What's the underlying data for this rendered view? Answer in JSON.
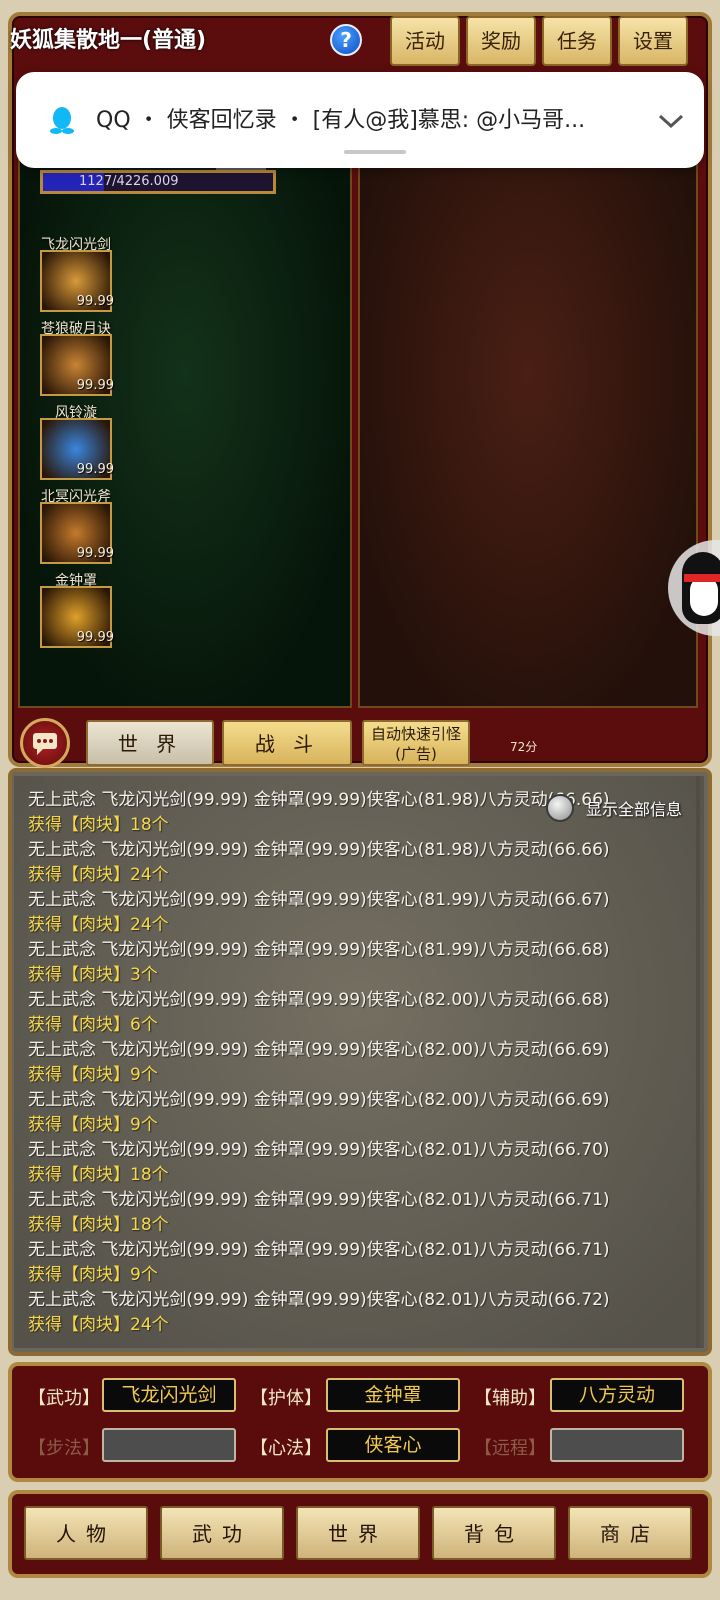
{
  "header": {
    "map_title": "妖狐集散地一(普通)",
    "help_glyph": "?",
    "buttons": [
      "活动",
      "奖励",
      "任务",
      "设置"
    ]
  },
  "notification": {
    "app": "QQ",
    "text": "QQ ・ 侠客回忆录 ・ [有人@我]慕思: @小马哥..."
  },
  "player": {
    "hp_text": "1127/4226.009",
    "hp_fraction": 0.267
  },
  "skills": [
    {
      "name": "飞龙闪光剑",
      "value": "99.99",
      "icon": "sword-slash-icon",
      "color": "#d89a3a"
    },
    {
      "name": "苍狼破月诀",
      "value": "99.99",
      "icon": "crescent-slash-icon",
      "color": "#c98435"
    },
    {
      "name": "风铃漩",
      "value": "99.99",
      "icon": "whirlwind-icon",
      "color": "#3a86e0"
    },
    {
      "name": "北冥闪光斧",
      "value": "99.99",
      "icon": "axe-icon",
      "color": "#c57a2c"
    },
    {
      "name": "金钟罩",
      "value": "99.99",
      "icon": "golden-bell-shield-icon",
      "color": "#e0a12a"
    }
  ],
  "chat_tabs": {
    "world": "世 界",
    "battle": "战 斗",
    "auto_line1": "自动快速引怪",
    "auto_line2": "(广告)",
    "score": "72分"
  },
  "log": {
    "show_all_label": "显示全部信息",
    "lines": [
      {
        "type": "info",
        "text": "无上武念 飞龙闪光剑(99.99) 金钟罩(99.99)侠客心(81.98)八方灵动(66.66)"
      },
      {
        "type": "gain",
        "text": "获得【肉块】18个"
      },
      {
        "type": "info",
        "text": "无上武念 飞龙闪光剑(99.99) 金钟罩(99.99)侠客心(81.98)八方灵动(66.66)"
      },
      {
        "type": "gain",
        "text": "获得【肉块】24个"
      },
      {
        "type": "info",
        "text": "无上武念 飞龙闪光剑(99.99) 金钟罩(99.99)侠客心(81.99)八方灵动(66.67)"
      },
      {
        "type": "gain",
        "text": "获得【肉块】24个"
      },
      {
        "type": "info",
        "text": "无上武念 飞龙闪光剑(99.99) 金钟罩(99.99)侠客心(81.99)八方灵动(66.68)"
      },
      {
        "type": "gain",
        "text": "获得【肉块】3个"
      },
      {
        "type": "info",
        "text": "无上武念 飞龙闪光剑(99.99) 金钟罩(99.99)侠客心(82.00)八方灵动(66.68)"
      },
      {
        "type": "gain",
        "text": "获得【肉块】6个"
      },
      {
        "type": "info",
        "text": "无上武念 飞龙闪光剑(99.99) 金钟罩(99.99)侠客心(82.00)八方灵动(66.69)"
      },
      {
        "type": "gain",
        "text": "获得【肉块】9个"
      },
      {
        "type": "info",
        "text": "无上武念 飞龙闪光剑(99.99) 金钟罩(99.99)侠客心(82.00)八方灵动(66.69)"
      },
      {
        "type": "gain",
        "text": "获得【肉块】9个"
      },
      {
        "type": "info",
        "text": "无上武念 飞龙闪光剑(99.99) 金钟罩(99.99)侠客心(82.01)八方灵动(66.70)"
      },
      {
        "type": "gain",
        "text": "获得【肉块】18个"
      },
      {
        "type": "info",
        "text": "无上武念 飞龙闪光剑(99.99) 金钟罩(99.99)侠客心(82.01)八方灵动(66.71)"
      },
      {
        "type": "gain",
        "text": "获得【肉块】18个"
      },
      {
        "type": "info",
        "text": "无上武念 飞龙闪光剑(99.99) 金钟罩(99.99)侠客心(82.01)八方灵动(66.71)"
      },
      {
        "type": "gain",
        "text": "获得【肉块】9个"
      },
      {
        "type": "info",
        "text": "无上武念 飞龙闪光剑(99.99) 金钟罩(99.99)侠客心(82.01)八方灵动(66.72)"
      },
      {
        "type": "gain",
        "text": "获得【肉块】24个"
      }
    ]
  },
  "equip": {
    "wugong_label": "【武功】",
    "wugong_value": "飞龙闪光剑",
    "hути_placeholder": "",
    "huti_label": "【护体】",
    "huti_value": "金钟罩",
    "fuzhu_label": "【辅助】",
    "fuzhu_value": "八方灵动",
    "bufa_label": "【步法】",
    "bufa_value": "",
    "xinfa_label": "【心法】",
    "xinfa_value": "侠客心",
    "yuancheng_label": "【远程】",
    "yuancheng_value": ""
  },
  "nav": [
    "人物",
    "武功",
    "世界",
    "背包",
    "商店"
  ],
  "colors": {
    "frame_red": "#5a0c0c",
    "gold_border": "#b08842",
    "gain_text": "#f6d84a",
    "equip_text": "#f2c94c"
  }
}
